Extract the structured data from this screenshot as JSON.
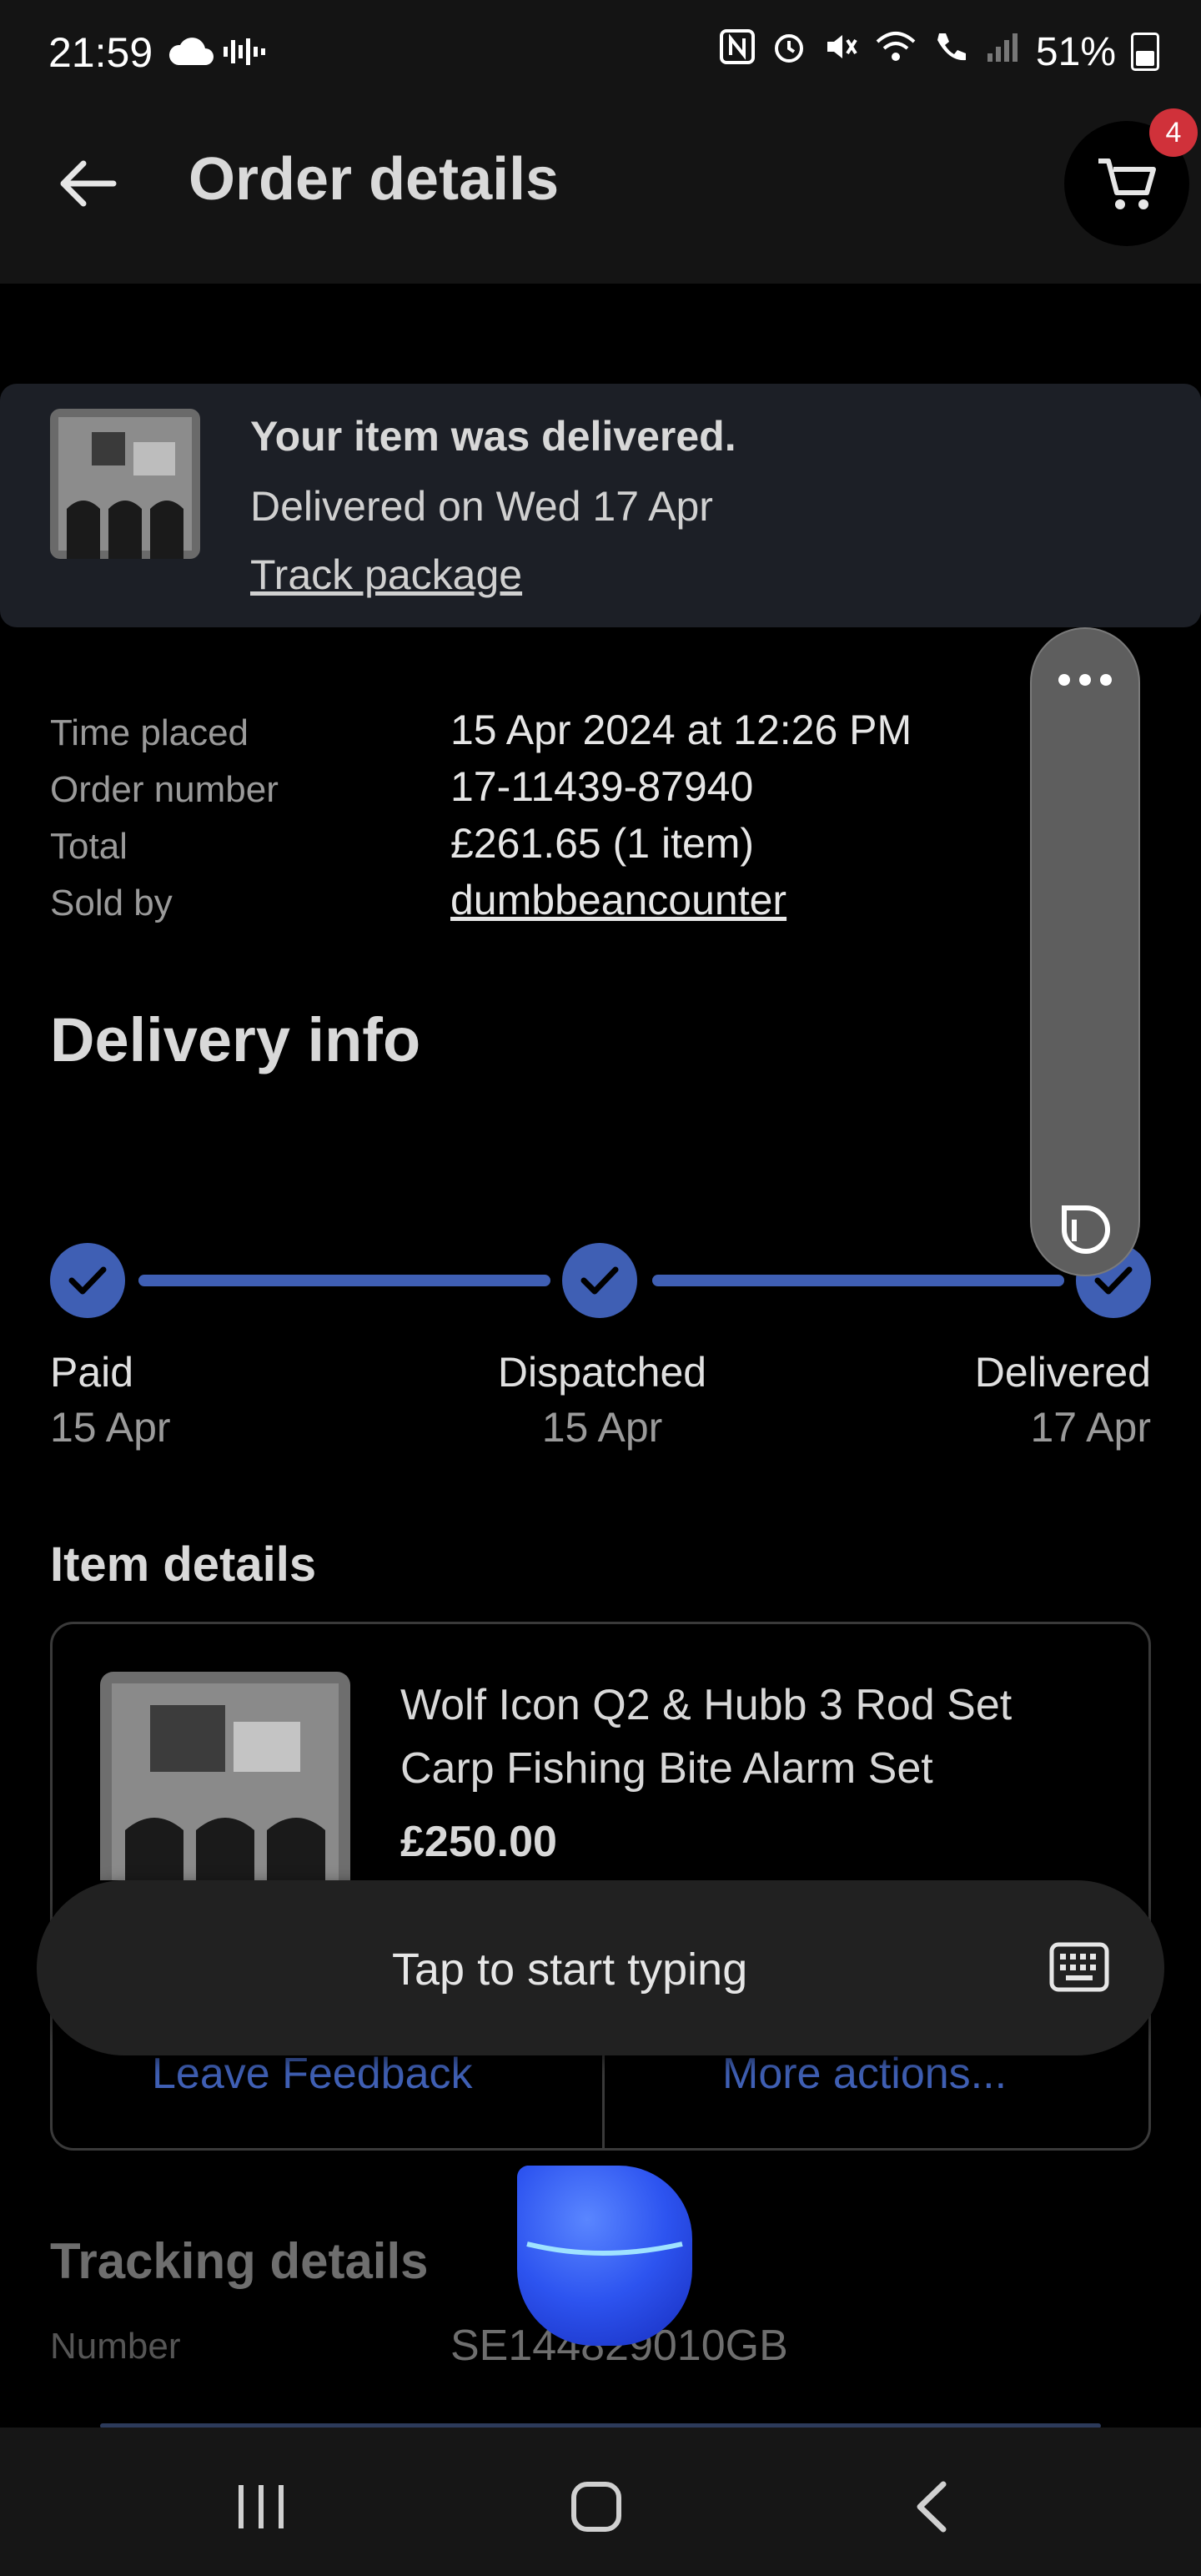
{
  "status_bar": {
    "time": "21:59",
    "battery": "51%"
  },
  "app_bar": {
    "title": "Order details",
    "cart_count": "4"
  },
  "banner": {
    "title": "Your item was delivered.",
    "subtitle": "Delivered on Wed 17 Apr",
    "link": "Track package"
  },
  "order_info": [
    {
      "label": "Time placed",
      "value": "15 Apr 2024 at 12:26 PM"
    },
    {
      "label": "Order number",
      "value": "17-11439-87940"
    },
    {
      "label": "Total",
      "value": "£261.65 (1 item)"
    },
    {
      "label": "Sold by",
      "value": "dumbbeancounter"
    }
  ],
  "delivery": {
    "title": "Delivery info",
    "steps": [
      {
        "label": "Paid",
        "date": "15 Apr"
      },
      {
        "label": "Dispatched",
        "date": "15 Apr"
      },
      {
        "label": "Delivered",
        "date": "17 Apr"
      }
    ]
  },
  "item": {
    "section_title": "Item details",
    "title": "Wolf Icon Q2 & Hubb 3 Rod Set Carp Fishing Bite Alarm Set",
    "price": "£250.00",
    "action_left": "Leave Feedback",
    "action_right": "More actions..."
  },
  "typing_bar": {
    "text": "Tap to start typing"
  },
  "tracking": {
    "title": "Tracking details",
    "label": "Number",
    "value": "SE144829010GB"
  },
  "colors": {
    "accent": "#3f5fb4",
    "badge": "#d0313a",
    "background": "#000000"
  }
}
